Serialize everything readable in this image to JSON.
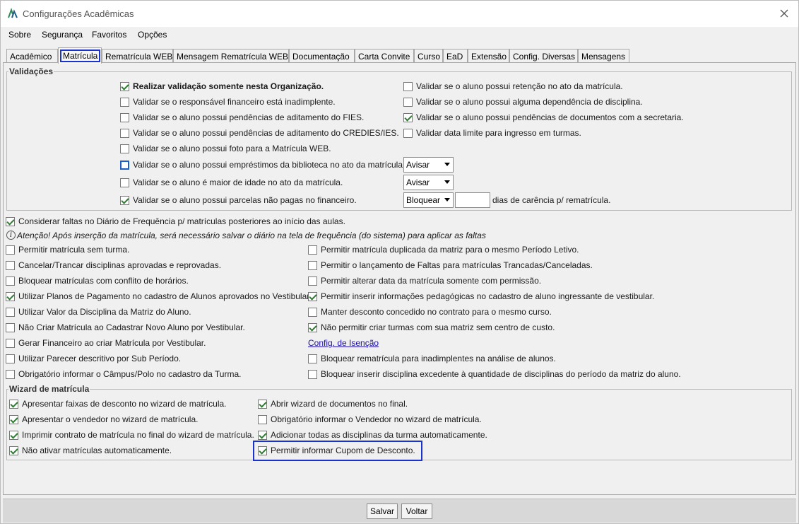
{
  "window": {
    "title": "Configurações Acadêmicas"
  },
  "menu": [
    "Sobre",
    "Segurança",
    "Favoritos",
    "Opções"
  ],
  "tabs": [
    "Acadêmico",
    "Matrícula",
    "Rematrícula WEB",
    "Mensagem Rematrícula WEB",
    "Documentação",
    "Carta Convite",
    "Curso",
    "EaD",
    "Extensão",
    "Config. Diversas",
    "Mensagens"
  ],
  "active_tab": "Matrícula",
  "validacoes": {
    "title": "Validações",
    "left": [
      {
        "label": "Realizar validação somente nesta Organização.",
        "checked": true
      },
      {
        "label": "Validar se o responsável financeiro está inadimplente.",
        "checked": false
      },
      {
        "label": "Validar se o aluno possui pendências de aditamento do FIES.",
        "checked": false
      },
      {
        "label": "Validar se o aluno possui pendências de aditamento do CREDIES/IES.",
        "checked": false
      },
      {
        "label": "Validar se o aluno possui foto para a Matrícula WEB.",
        "checked": false
      },
      {
        "label": "Validar se o aluno possui empréstimos da biblioteca no ato da matrícula.",
        "checked": false
      },
      {
        "label": "Validar se o aluno é maior de idade no ato da matrícula.",
        "checked": false
      },
      {
        "label": "Validar se o aluno possui parcelas não pagas no financeiro.",
        "checked": true
      }
    ],
    "right": [
      {
        "label": "Validar se o aluno possui retenção no ato da matrícula.",
        "checked": false
      },
      {
        "label": "Validar se o aluno possui alguma dependência de disciplina.",
        "checked": false
      },
      {
        "label": "Validar se o aluno possui pendências de documentos com a secretaria.",
        "checked": true
      },
      {
        "label": "Validar data limite para ingresso em turmas.",
        "checked": false
      }
    ],
    "select_biblioteca": "Avisar",
    "select_maior_idade": "Avisar",
    "select_parcelas": "Bloquear",
    "carencia_value": "",
    "carencia_label": "dias de carência p/ rematrícula."
  },
  "faltas": {
    "label": "Considerar faltas no Diário de Frequência p/ matrículas posteriores ao início das aulas.",
    "checked": true,
    "notice": "Atenção! Após inserção da matrícula, será necessário salvar o diário na tela de frequência (do sistema) para aplicar as faltas"
  },
  "opcoes": {
    "left": [
      {
        "label": "Permitir matrícula sem turma.",
        "checked": false
      },
      {
        "label": "Cancelar/Trancar disciplinas aprovadas e reprovadas.",
        "checked": false
      },
      {
        "label": "Bloquear matrículas com conflito de horários.",
        "checked": false
      },
      {
        "label": "Utilizar Planos de Pagamento no cadastro de Alunos aprovados no Vestibular.",
        "checked": true
      },
      {
        "label": "Utilizar Valor da Disciplina da Matriz do Aluno.",
        "checked": false
      },
      {
        "label": "Não Criar Matrícula ao Cadastrar Novo Aluno por Vestibular.",
        "checked": false
      },
      {
        "label": "Gerar Financeiro ao criar Matrícula por Vestibular.",
        "checked": false
      },
      {
        "label": "Utilizar Parecer descritivo por Sub Período.",
        "checked": false
      },
      {
        "label": "Obrigatório informar o Câmpus/Polo no cadastro da Turma.",
        "checked": false
      }
    ],
    "right": [
      {
        "label": "Permitir matrícula duplicada da matriz para o mesmo Período Letivo.",
        "checked": false
      },
      {
        "label": "Permitir o lançamento de Faltas para matrículas Trancadas/Canceladas.",
        "checked": false
      },
      {
        "label": "Permitir alterar data da matrícula somente com permissão.",
        "checked": false
      },
      {
        "label": "Permitir inserir informações pedagógicas no cadastro de aluno ingressante de vestibular.",
        "checked": true
      },
      {
        "label": "Manter desconto concedido no contrato para o mesmo curso.",
        "checked": false
      },
      {
        "label": "Não permitir criar turmas com sua matriz sem centro de custo.",
        "checked": true
      }
    ],
    "link_isencao": "Config. de Isenção",
    "right_after_link": [
      {
        "label": "Bloquear rematrícula para inadimplentes na análise de alunos.",
        "checked": false
      },
      {
        "label": "Bloquear inserir disciplina excedente à quantidade de disciplinas do período da matriz do aluno.",
        "checked": false
      }
    ]
  },
  "wizard": {
    "title": "Wizard de matrícula",
    "left": [
      {
        "label": "Apresentar faixas de desconto no wizard de matrícula.",
        "checked": true
      },
      {
        "label": "Apresentar o vendedor no wizard de matrícula.",
        "checked": true
      },
      {
        "label": "Imprimir contrato de matrícula no final do wizard de matrícula.",
        "checked": true
      },
      {
        "label": "Não ativar matrículas automaticamente.",
        "checked": true
      }
    ],
    "right": [
      {
        "label": "Abrir wizard de documentos no final.",
        "checked": true
      },
      {
        "label": "Obrigatório informar o Vendedor no wizard de matrícula.",
        "checked": false
      },
      {
        "label": "Adicionar todas as disciplinas da turma automaticamente.",
        "checked": true
      },
      {
        "label": "Permitir informar Cupom de Desconto.",
        "checked": true
      }
    ]
  },
  "buttons": {
    "save": "Salvar",
    "back": "Voltar"
  },
  "colors": {
    "highlight": "#1a33cc",
    "check": "#2e7d32",
    "link": "#1a0dab"
  }
}
